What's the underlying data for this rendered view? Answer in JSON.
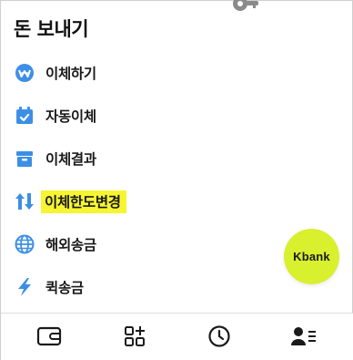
{
  "header": {
    "title": "돈 보내기"
  },
  "menu": {
    "items": [
      {
        "icon": "won-circle-icon",
        "label": "이체하기"
      },
      {
        "icon": "calendar-check-icon",
        "label": "자동이체"
      },
      {
        "icon": "archive-box-icon",
        "label": "이체결과"
      },
      {
        "icon": "up-down-arrows-icon",
        "label": "이체한도변경",
        "highlighted": true
      },
      {
        "icon": "globe-icon",
        "label": "해외송금"
      },
      {
        "icon": "lightning-icon",
        "label": "퀵송금"
      }
    ]
  },
  "fab": {
    "label": "Kbank",
    "color": "#d8f02e"
  },
  "bottom_nav": {
    "tabs": [
      {
        "icon": "wallet-icon"
      },
      {
        "icon": "grid-plus-icon"
      },
      {
        "icon": "clock-icon"
      },
      {
        "icon": "user-list-icon",
        "active": true
      }
    ]
  },
  "colors": {
    "accent_blue": "#3d8fe6",
    "highlight": "#f7f532",
    "text": "#1a1a1a"
  }
}
